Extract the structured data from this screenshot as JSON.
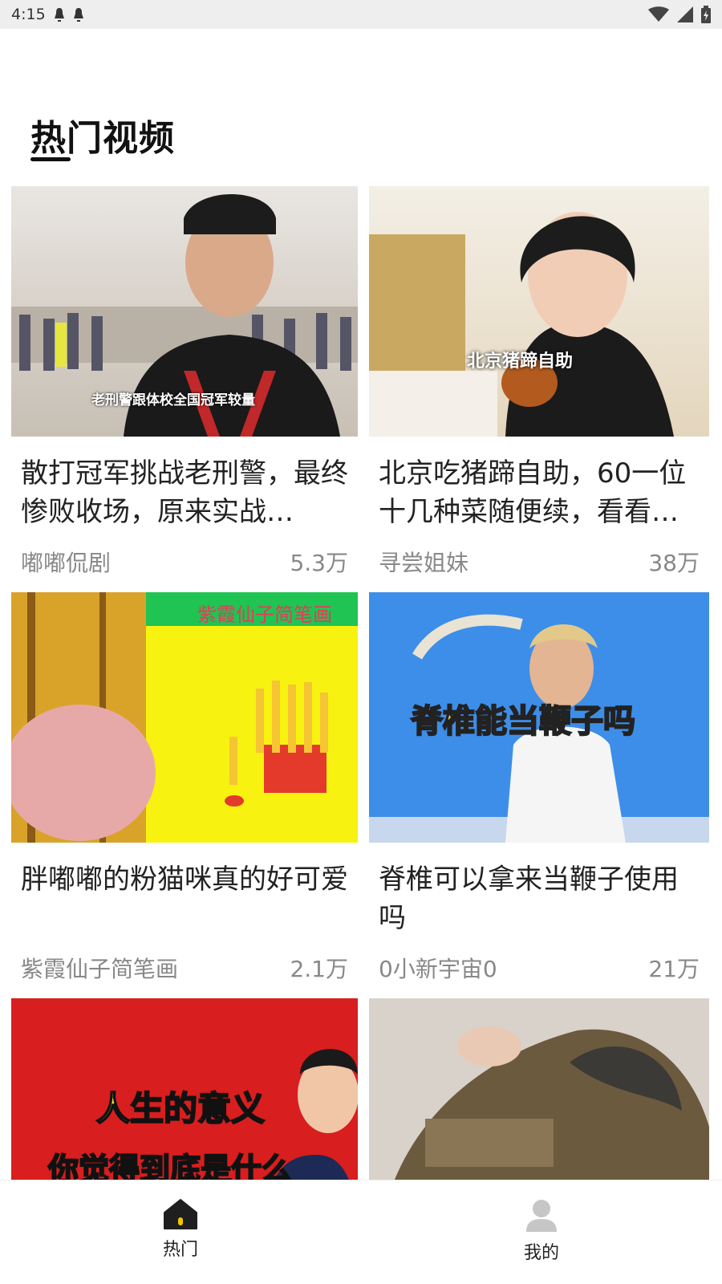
{
  "status_bar": {
    "time": "4:15"
  },
  "header": {
    "title": "热门视频"
  },
  "cards": [
    {
      "title": "散打冠军挑战老刑警，最终惨败收场，原来实战…",
      "author": "嘟嘟侃剧",
      "views": "5.3万",
      "thumb_caption": "老刑警跟体校全国冠军较量"
    },
    {
      "title": "北京吃猪蹄自助，60一位十几种菜随便续，看看…",
      "author": "寻尝姐妹",
      "views": "38万",
      "thumb_caption": "北京猪蹄自助"
    },
    {
      "title": "胖嘟嘟的粉猫咪真的好可爱",
      "author": "紫霞仙子简笔画",
      "views": "2.1万",
      "thumb_caption": "紫霞仙子简笔画"
    },
    {
      "title": "脊椎可以拿来当鞭子使用吗",
      "author": "0小新宇宙0",
      "views": "21万",
      "thumb_caption": "脊椎能当鞭子吗"
    },
    {
      "thumb_caption": "人生的意义",
      "thumb_caption_2": "你觉得到底是什么"
    },
    {}
  ],
  "bottom_nav": [
    {
      "label": "热门",
      "icon": "home-icon"
    },
    {
      "label": "我的",
      "icon": "profile-icon"
    }
  ],
  "colors": {
    "accent_text": "#111111",
    "meta_text": "#888888",
    "thumb_red": "#d81e1e",
    "thumb_yellow": "#f7f20f",
    "thumb_blue": "#3d8ee8"
  }
}
